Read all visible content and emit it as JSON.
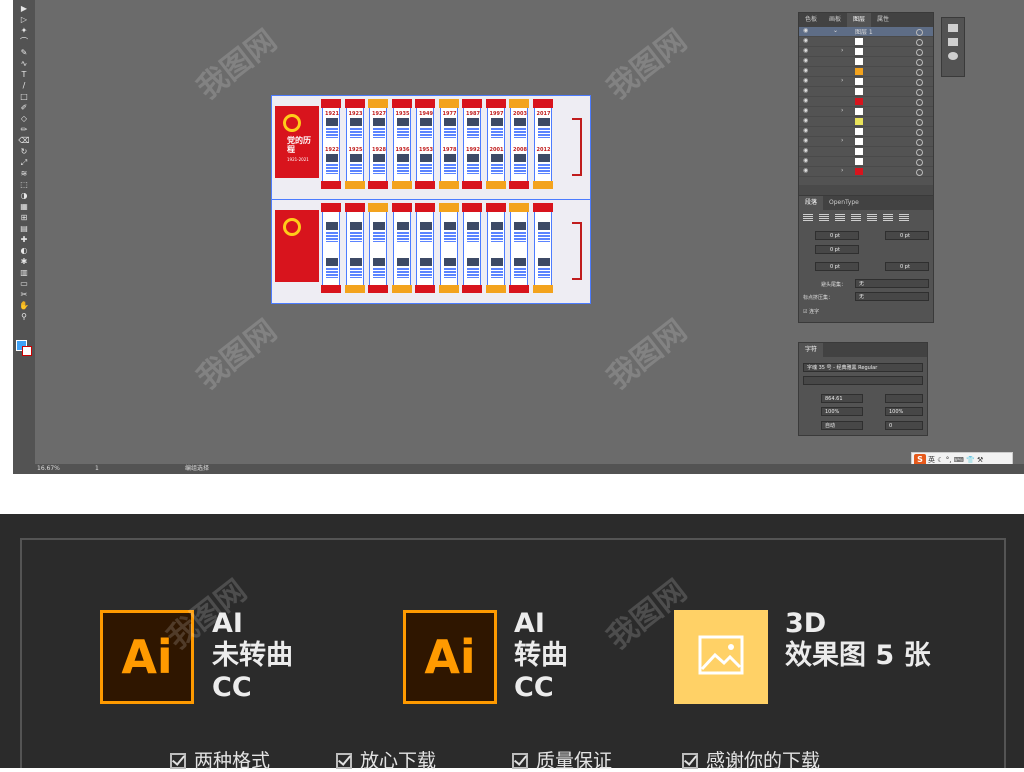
{
  "toolbar": {
    "tools": [
      "selection-tool",
      "direct-selection-tool",
      "magic-wand-tool",
      "lasso-tool",
      "pen-tool",
      "curvature-tool",
      "type-tool",
      "line-tool",
      "rectangle-tool",
      "paintbrush-tool",
      "shaper-tool",
      "pencil-tool",
      "eraser-tool",
      "rotate-tool",
      "scale-tool",
      "width-tool",
      "free-transform-tool",
      "shape-builder-tool",
      "perspective-grid-tool",
      "mesh-tool",
      "gradient-tool",
      "eyedropper-tool",
      "blend-tool",
      "symbol-sprayer-tool",
      "column-graph-tool",
      "artboard-tool",
      "slice-tool",
      "hand-tool",
      "zoom-tool"
    ]
  },
  "status": {
    "zoom": "16.67%",
    "artboard_number": "1",
    "tool_name": "编组选择"
  },
  "artboards": {
    "top": {
      "flag_title": "党的历程",
      "flag_dates": "1921-2021",
      "years_row1": [
        "1921",
        "1923",
        "1927",
        "1935",
        "1949",
        "1977",
        "1987",
        "1997",
        "2003",
        "2017"
      ],
      "years_row2": [
        "1922",
        "1925",
        "1928",
        "1936",
        "1953",
        "1978",
        "1992",
        "2001",
        "2008",
        "2012"
      ]
    }
  },
  "panels": {
    "layers": {
      "tabs": [
        "色板",
        "画板",
        "图层",
        "属性"
      ],
      "active_tab": "图层",
      "layer_name": "图层 1"
    },
    "paragraph": {
      "tabs": [
        "段落",
        "OpenType"
      ],
      "indent_left": "0 pt",
      "indent_right": "0 pt",
      "first_line": "0 pt",
      "space_before": "0 pt",
      "space_after": "0 pt",
      "kinsoku_label": "避头尾集：",
      "kinsoku_value": "无",
      "mojikumi_label": "标点挤压集：",
      "mojikumi_value": "无",
      "hyphenate_label": "连字"
    },
    "character": {
      "tab": "字符",
      "font_family": "字魂 35 号 - 经典雅黑 Regular",
      "font_size": "864.61",
      "vertical_scale": "100%",
      "horizontal_scale": "100%",
      "leading": "自动",
      "tracking": "0"
    }
  },
  "ime": {
    "logo": "S",
    "lang": "英"
  },
  "promo": {
    "features": [
      {
        "icon_text": "Ai",
        "lines": [
          "AI",
          "未转曲",
          "CC"
        ]
      },
      {
        "icon_text": "Ai",
        "lines": [
          "AI",
          "转曲",
          "CC"
        ]
      },
      {
        "icon_text": "",
        "lines": [
          "3D",
          "效果图 5 张"
        ]
      }
    ],
    "checks": [
      "两种格式",
      "放心下载",
      "质量保证",
      "感谢你的下载"
    ]
  },
  "watermark": "我图网",
  "colors": {
    "workspace_bg": "#6b6b6b",
    "panel_bg": "#535353",
    "party_red": "#d8141d",
    "accent_orange": "#f3a31d",
    "ai_orange": "#ff9a00",
    "promo_bg": "#2b2b2b"
  }
}
